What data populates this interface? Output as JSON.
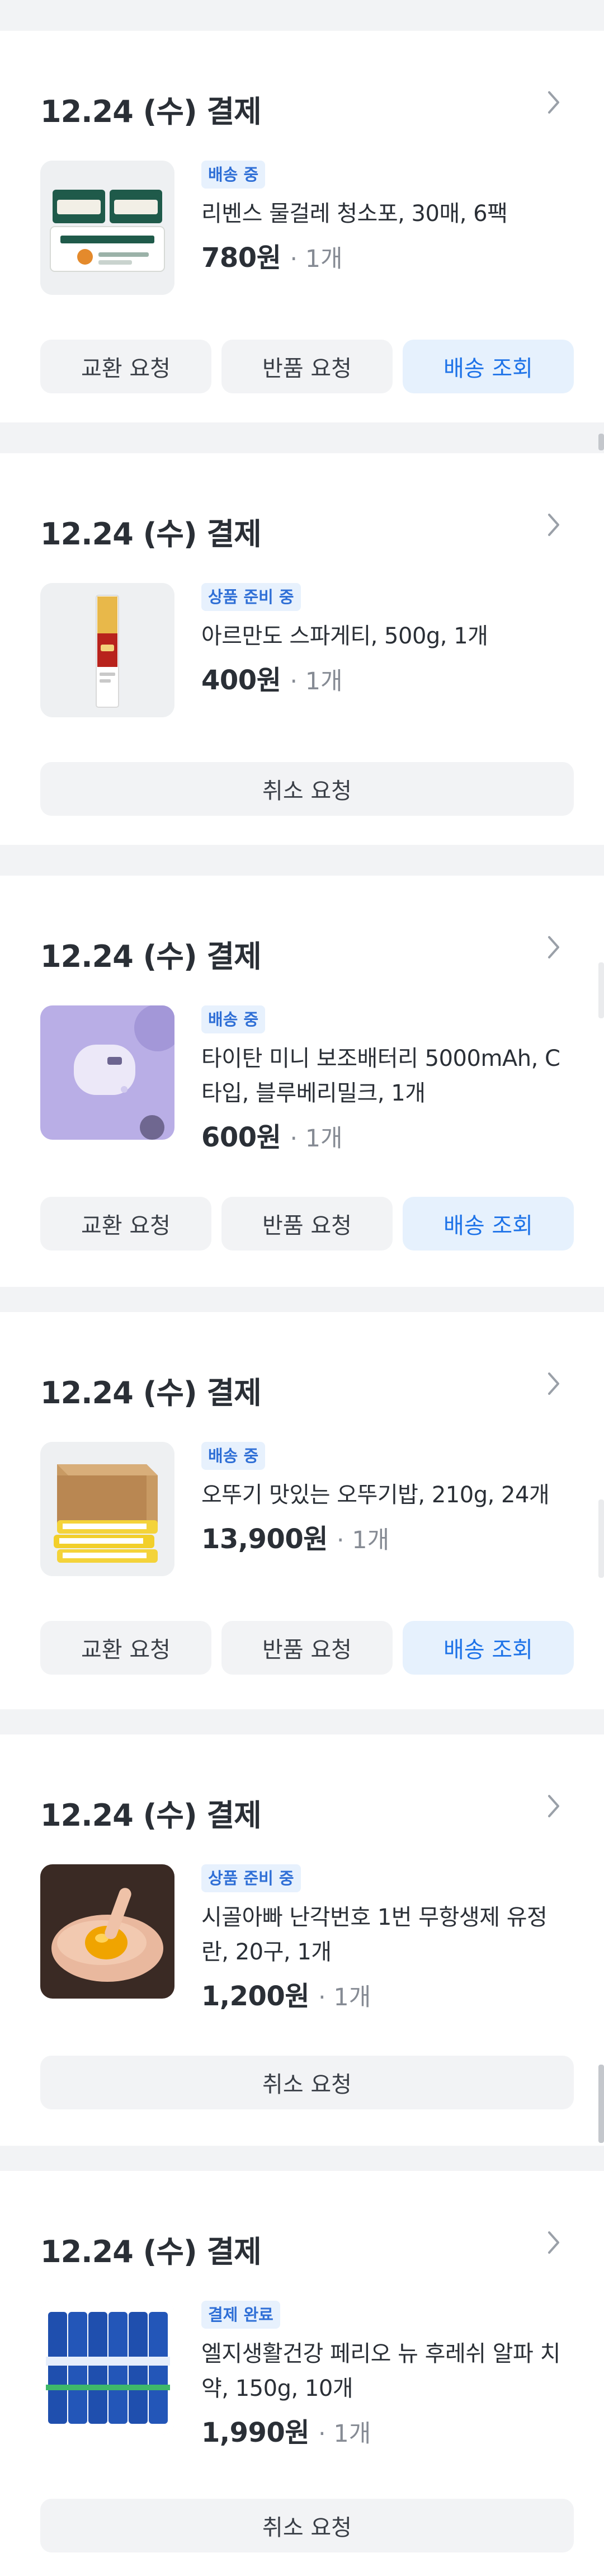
{
  "orders": [
    {
      "date": "12.24 (수) 결제",
      "status": "배송 중",
      "title": "리벤스 물걸레 청소포, 30매, 6팩",
      "price": "780원",
      "qty": "· 1개",
      "buttons": [
        "교환 요청",
        "반품 요청",
        "배송 조회"
      ],
      "image": "mop-pads"
    },
    {
      "date": "12.24 (수) 결제",
      "status": "상품 준비 중",
      "title": "아르만도 스파게티, 500g, 1개",
      "price": "400원",
      "qty": "· 1개",
      "buttons": [
        "취소 요청"
      ],
      "image": "spaghetti"
    },
    {
      "date": "12.24 (수) 결제",
      "status": "배송 중",
      "title": "타이탄 미니 보조배터리 5000mAh, C타입, 블루베리밀크, 1개",
      "price": "600원",
      "qty": "· 1개",
      "buttons": [
        "교환 요청",
        "반품 요청",
        "배송 조회"
      ],
      "image": "power-bank"
    },
    {
      "date": "12.24 (수) 결제",
      "status": "배송 중",
      "title": "오뚜기 맛있는 오뚜기밥, 210g, 24개",
      "price": "13,900원",
      "qty": "· 1개",
      "buttons": [
        "교환 요청",
        "반품 요청",
        "배송 조회"
      ],
      "image": "rice-box"
    },
    {
      "date": "12.24 (수) 결제",
      "status": "상품 준비 중",
      "title": "시골아빠 난각번호 1번 무항생제 유정란, 20구, 1개",
      "price": "1,200원",
      "qty": "· 1개",
      "buttons": [
        "취소 요청"
      ],
      "image": "egg-yolk"
    },
    {
      "date": "12.24 (수) 결제",
      "status": "결제 완료",
      "title": "엘지생활건강 페리오 뉴 후레쉬 알파 치약, 150g, 10개",
      "price": "1,990원",
      "qty": "· 1개",
      "buttons": [
        "취소 요청"
      ],
      "image": "toothpaste"
    }
  ],
  "colors": {
    "accent": "#1e73e8",
    "badge_bg": "#e7f1fd",
    "background": "#f2f3f5"
  }
}
